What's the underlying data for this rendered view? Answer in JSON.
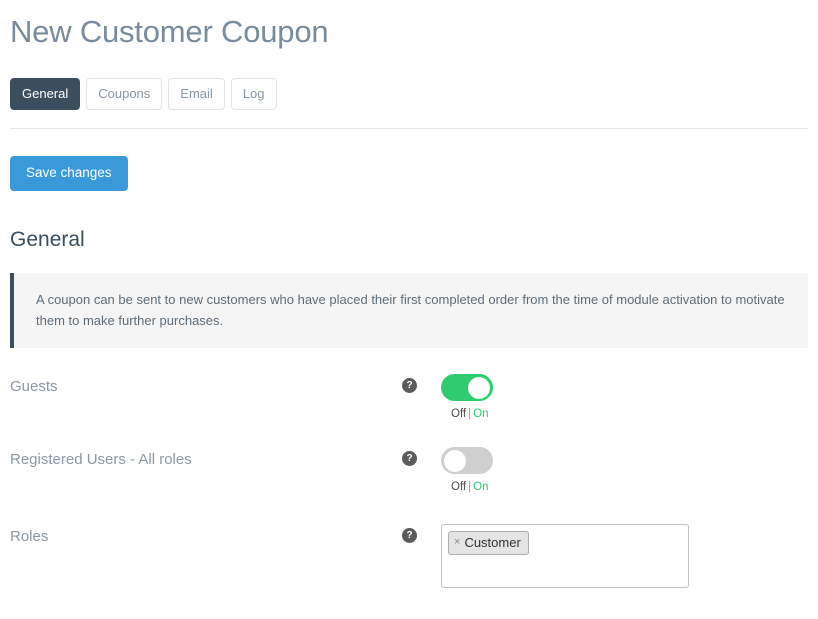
{
  "page": {
    "title": "New Customer Coupon"
  },
  "tabs": [
    {
      "label": "General",
      "active": true
    },
    {
      "label": "Coupons",
      "active": false
    },
    {
      "label": "Email",
      "active": false
    },
    {
      "label": "Log",
      "active": false
    }
  ],
  "toolbar": {
    "save_label": "Save changes"
  },
  "section": {
    "heading": "General",
    "info_text": "A coupon can be sent to new customers who have placed their first completed order from the time of module activation to motivate them to make further purchases."
  },
  "switch_labels": {
    "off": "Off",
    "separator": "|",
    "on": "On"
  },
  "fields": {
    "guests": {
      "label": "Guests",
      "help_icon": "question-mark-icon",
      "state": "on"
    },
    "registered_users": {
      "label": "Registered Users - All roles",
      "help_icon": "question-mark-icon",
      "state": "off"
    },
    "roles": {
      "label": "Roles",
      "help_icon": "question-mark-icon",
      "selected": [
        {
          "label": "Customer",
          "remove_icon": "×"
        }
      ]
    }
  },
  "colors": {
    "accent_blue": "#3a9ad9",
    "navy": "#3c4d5d",
    "green": "#2ecc6f",
    "title_gray": "#798b9c",
    "info_bg": "#f5f5f5"
  }
}
